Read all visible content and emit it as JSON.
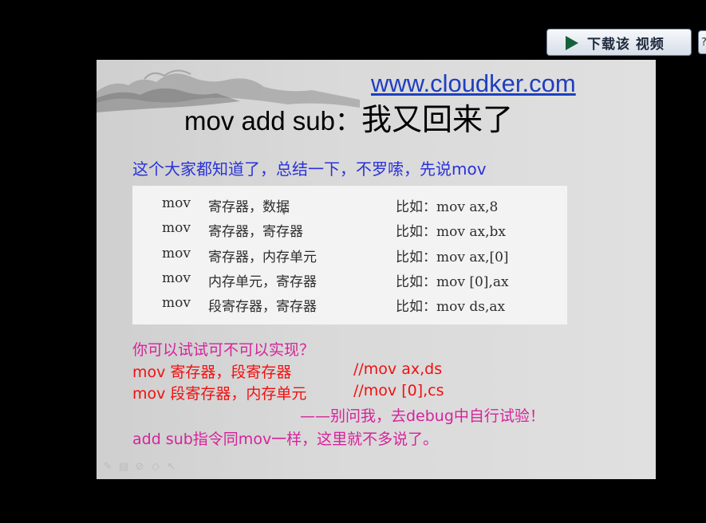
{
  "player": {
    "download_label": "下载该 视频",
    "help_label": "?"
  },
  "slide": {
    "url": "www.cloudker.com",
    "title_en": "mov add sub：",
    "title_cn": "我又回来了",
    "intro": "这个大家都知道了，总结一下，不罗嗦，先说mov",
    "table_rows": [
      {
        "op": "mov",
        "operands": "寄存器，数据",
        "example": "比如：mov ax,8"
      },
      {
        "op": "mov",
        "operands": "寄存器，寄存器",
        "example": "比如：mov ax,bx"
      },
      {
        "op": "mov",
        "operands": "寄存器，内存单元",
        "example": "比如：mov ax,[0]"
      },
      {
        "op": "mov",
        "operands": "内存单元，寄存器",
        "example": "比如：mov [0],ax"
      },
      {
        "op": "mov",
        "operands": "段寄存器，寄存器",
        "example": "比如：mov ds,ax"
      }
    ],
    "question": "你可以试试可不可以实现？",
    "try1": {
      "code": "mov 寄存器，段寄存器",
      "comment": "//mov ax,ds"
    },
    "try2": {
      "code": "mov 段寄存器，内存单元",
      "comment": "//mov [0],cs"
    },
    "hint": "——别问我，去debug中自行试验！",
    "note": "add sub指令同mov一样，这里就不多说了。"
  },
  "colors": {
    "background": "#000000",
    "slide_bg": "#d9d9d9",
    "link": "#1f3fc0",
    "intro_text": "#2a32d8",
    "pink_text": "#d6239b",
    "red_text": "#f01010"
  },
  "icons": [
    "play-icon",
    "pen-icon",
    "highlighter-icon",
    "eraser-icon",
    "marker-icon",
    "pointer-icon",
    "mountains-decoration"
  ]
}
